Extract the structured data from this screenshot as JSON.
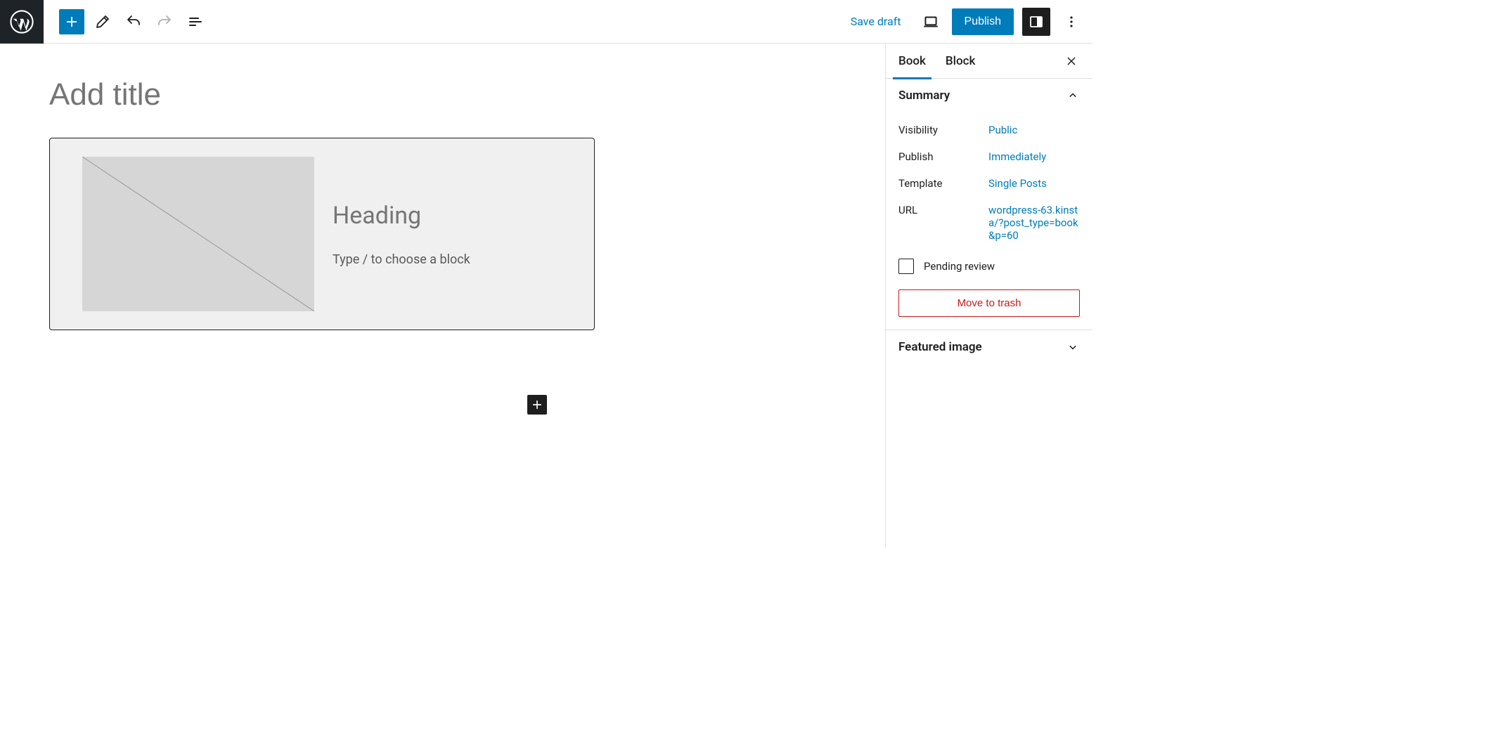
{
  "header": {
    "save_draft_label": "Save draft",
    "publish_label": "Publish"
  },
  "editor": {
    "title_placeholder": "Add title",
    "block_heading": "Heading",
    "block_hint": "Type / to choose a block"
  },
  "sidebar": {
    "tabs": [
      {
        "label": "Book"
      },
      {
        "label": "Block"
      }
    ],
    "summary": {
      "header": "Summary",
      "rows": {
        "visibility_label": "Visibility",
        "visibility_value": "Public",
        "publish_label": "Publish",
        "publish_value": "Immediately",
        "template_label": "Template",
        "template_value": "Single Posts",
        "url_label": "URL",
        "url_value": "wordpress-63.kinsta/?post_type=book&p=60"
      },
      "pending_review_label": "Pending review",
      "trash_label": "Move to trash"
    },
    "featured_image": {
      "header": "Featured image"
    }
  }
}
